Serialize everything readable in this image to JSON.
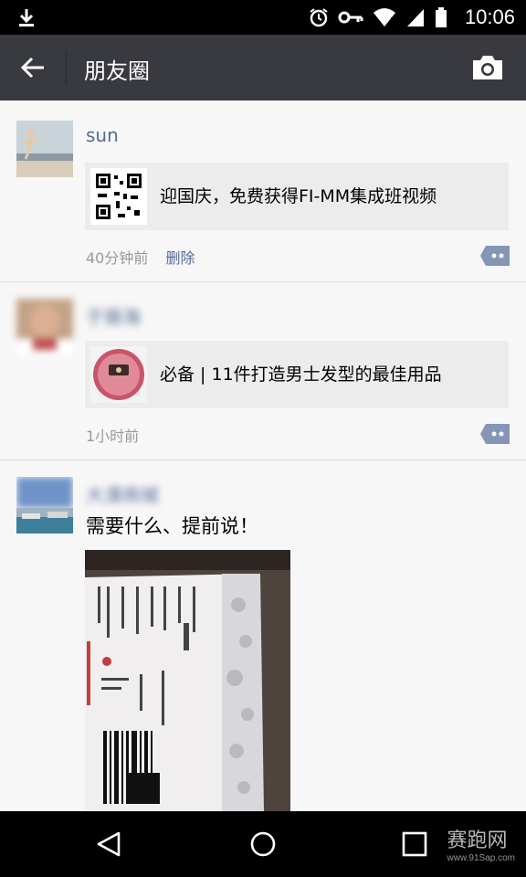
{
  "status_bar": {
    "time": "10:06"
  },
  "title_bar": {
    "title": "朋友圈"
  },
  "posts": [
    {
      "name": "sun",
      "share_text": "迎国庆，免费获得FI-MM集成班视频",
      "time": "40分钟前",
      "action": "删除"
    },
    {
      "name": "于振海",
      "share_text": "必备 | 11件打造男士发型的最佳用品",
      "time": "1小时前"
    },
    {
      "name": "大漠商城",
      "text": "需要什么、提前说！"
    }
  ],
  "watermark": {
    "main": "赛跑网",
    "sub": "www.91Sap.com"
  },
  "colors": {
    "title_bar": "#393a3f",
    "name_link": "#576b95",
    "feed_bg": "#f7f7f7"
  },
  "icons": {
    "status": [
      "download-icon",
      "alarm-icon",
      "key-icon",
      "wifi-icon",
      "signal-icon",
      "battery-icon"
    ],
    "title": [
      "back-arrow-icon",
      "camera-icon"
    ],
    "post": [
      "comment-icon"
    ],
    "nav": [
      "back-icon",
      "home-icon",
      "recents-icon"
    ]
  }
}
